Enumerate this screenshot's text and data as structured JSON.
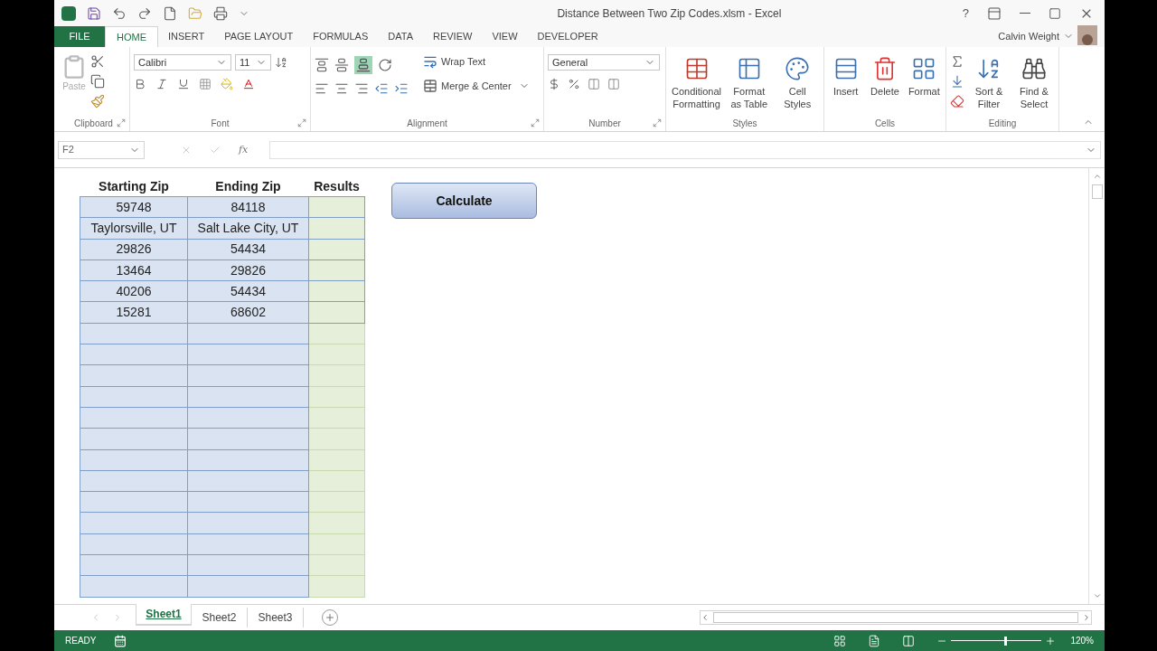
{
  "window": {
    "title": "Distance Between Two Zip Codes.xlsm - Excel",
    "help": "?",
    "user": "Calvin Weight"
  },
  "file_tab": "FILE",
  "tabs": [
    {
      "label": "HOME",
      "selected": true
    },
    {
      "label": "INSERT",
      "selected": false
    },
    {
      "label": "PAGE LAYOUT",
      "selected": false
    },
    {
      "label": "FORMULAS",
      "selected": false
    },
    {
      "label": "DATA",
      "selected": false
    },
    {
      "label": "REVIEW",
      "selected": false
    },
    {
      "label": "VIEW",
      "selected": false
    },
    {
      "label": "DEVELOPER",
      "selected": false
    }
  ],
  "ribbon": {
    "clipboard": {
      "label": "Clipboard",
      "paste": "Paste",
      "paste_disabled": true
    },
    "font": {
      "label": "Font",
      "name": "Calibri",
      "size": "11"
    },
    "alignment": {
      "label": "Alignment",
      "wrap": "Wrap Text",
      "merge": "Merge & Center"
    },
    "number": {
      "label": "Number",
      "format": "General"
    },
    "styles": {
      "label": "Styles",
      "buttons": [
        "Conditional Formatting",
        "Format as Table",
        "Cell Styles"
      ]
    },
    "cells": {
      "label": "Cells",
      "buttons": [
        "Insert",
        "Delete",
        "Format"
      ]
    },
    "editing": {
      "label": "Editing",
      "buttons": [
        "Sort & Filter",
        "Find & Select"
      ]
    }
  },
  "formula_bar": {
    "name_box": "F2",
    "function_glyph": "fx"
  },
  "table": {
    "columns": [
      "Starting Zip",
      "Ending Zip",
      "Results"
    ],
    "rows": [
      [
        "59748",
        "84118"
      ],
      [
        "Taylorsville, UT",
        "Salt Lake City, UT"
      ],
      [
        "29826",
        "54434"
      ],
      [
        "13464",
        "29826"
      ],
      [
        "40206",
        "54434"
      ],
      [
        "15281",
        "68602"
      ]
    ]
  },
  "calculate_button": "Calculate",
  "sheets": [
    {
      "label": "Sheet1",
      "selected": true
    },
    {
      "label": "Sheet2",
      "selected": false
    },
    {
      "label": "Sheet3",
      "selected": false
    }
  ],
  "status_bar": {
    "mode": "READY",
    "zoom": "120%",
    "zoom_slider": {
      "level": 0.6
    }
  }
}
